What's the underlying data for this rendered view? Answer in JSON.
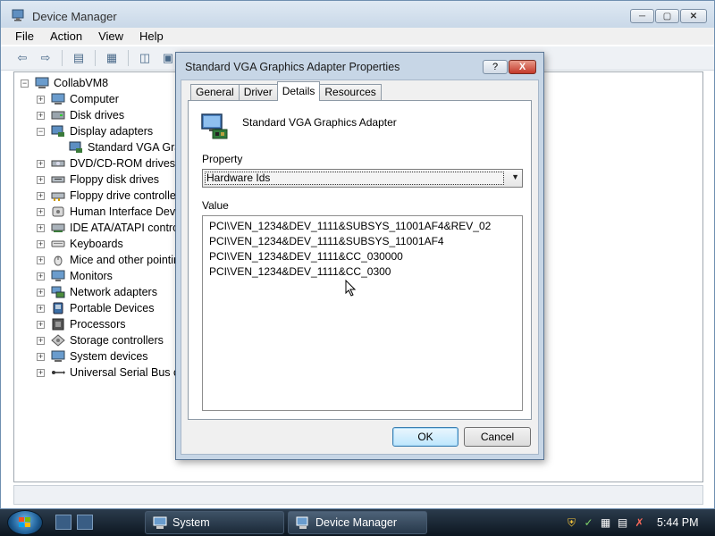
{
  "window": {
    "title": "Device Manager"
  },
  "menu": [
    "File",
    "Action",
    "View",
    "Help"
  ],
  "tree": {
    "root": "CollabVM8",
    "items": [
      {
        "label": "Computer",
        "expanded": false
      },
      {
        "label": "Disk drives",
        "expanded": false
      },
      {
        "label": "Display adapters",
        "expanded": true
      },
      {
        "label": "Standard VGA Grap",
        "child": true
      },
      {
        "label": "DVD/CD-ROM drives",
        "expanded": false
      },
      {
        "label": "Floppy disk drives",
        "expanded": false
      },
      {
        "label": "Floppy drive controller",
        "expanded": false
      },
      {
        "label": "Human Interface Devic",
        "expanded": false
      },
      {
        "label": "IDE ATA/ATAPI contro",
        "expanded": false
      },
      {
        "label": "Keyboards",
        "expanded": false
      },
      {
        "label": "Mice and other pointin",
        "expanded": false
      },
      {
        "label": "Monitors",
        "expanded": false
      },
      {
        "label": "Network adapters",
        "expanded": false
      },
      {
        "label": "Portable Devices",
        "expanded": false
      },
      {
        "label": "Processors",
        "expanded": false
      },
      {
        "label": "Storage controllers",
        "expanded": false
      },
      {
        "label": "System devices",
        "expanded": false
      },
      {
        "label": "Universal Serial Bus co",
        "expanded": false
      }
    ]
  },
  "dialog": {
    "title": "Standard VGA Graphics Adapter Properties",
    "help": "?",
    "close": "X",
    "tabs": [
      "General",
      "Driver",
      "Details",
      "Resources"
    ],
    "active_tab": "Details",
    "device_name": "Standard VGA Graphics Adapter",
    "property_label": "Property",
    "property_value": "Hardware Ids",
    "value_label": "Value",
    "values": [
      "PCI\\VEN_1234&DEV_1111&SUBSYS_11001AF4&REV_02",
      "PCI\\VEN_1234&DEV_1111&SUBSYS_11001AF4",
      "PCI\\VEN_1234&DEV_1111&CC_030000",
      "PCI\\VEN_1234&DEV_1111&CC_0300"
    ],
    "ok": "OK",
    "cancel": "Cancel"
  },
  "taskbar": {
    "tasks": [
      "System",
      "Device Manager"
    ],
    "clock": "5:44 PM"
  }
}
